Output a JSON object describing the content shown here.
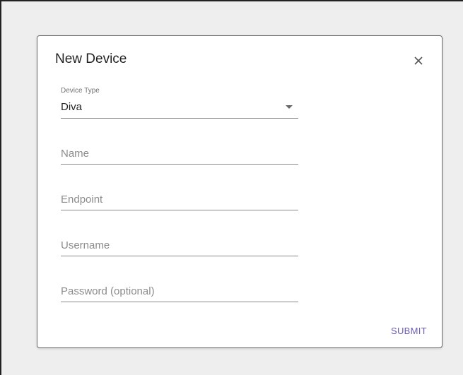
{
  "dialog": {
    "title": "New Device",
    "close_icon": "close-icon",
    "device_type": {
      "label": "Device Type",
      "value": "Diva",
      "arrow_icon": "dropdown-arrow-icon"
    },
    "fields": {
      "name_placeholder": "Name",
      "endpoint_placeholder": "Endpoint",
      "username_placeholder": "Username",
      "password_placeholder": "Password (optional)"
    },
    "submit_label": "SUBMIT"
  },
  "colors": {
    "backdrop": "#eeeeee",
    "accent": "#6a5fb5",
    "underline": "#8a8a8a"
  }
}
